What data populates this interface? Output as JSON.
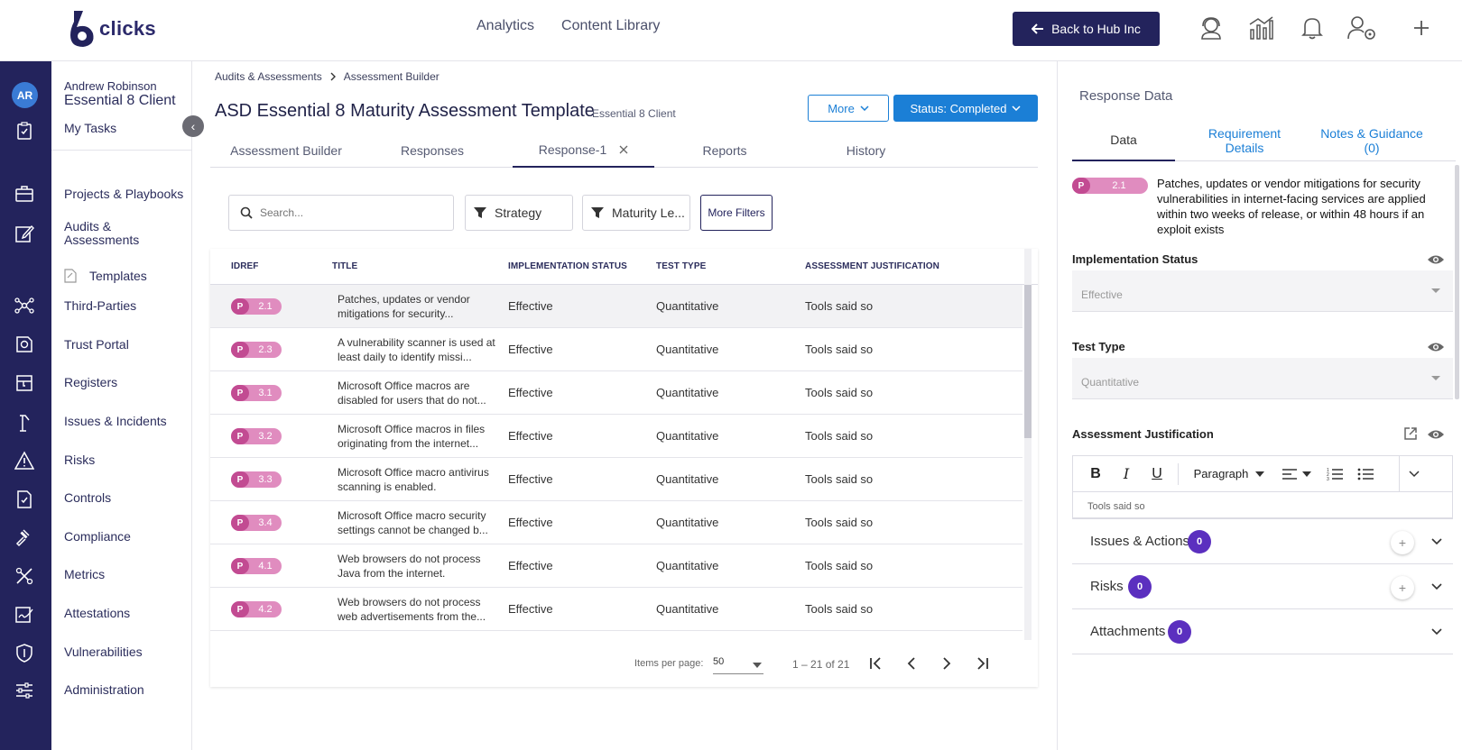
{
  "app": {
    "logo_text": "clicks",
    "nav": [
      "Analytics",
      "Content Library"
    ],
    "back_button": "Back to Hub Inc",
    "header_icons": [
      "support-icon",
      "analytics-icon",
      "bell-icon",
      "user-settings-icon",
      "plus-icon"
    ],
    "colors": {
      "navy": "#23235c",
      "blue": "#1b7fd6",
      "badge_pink": "#e08cbf",
      "badge_dark": "#c24b92",
      "count_purple": "#5b2fbf"
    }
  },
  "user": {
    "initials": "AR",
    "name": "Andrew Robinson",
    "client": "Essential 8 Client"
  },
  "sidebar": {
    "items": [
      {
        "label": "My Tasks"
      },
      {
        "label": "Projects & Playbooks"
      },
      {
        "label": "Audits & Assessments"
      },
      {
        "label": "Templates"
      },
      {
        "label": "Third-Parties"
      },
      {
        "label": "Trust Portal"
      },
      {
        "label": "Registers"
      },
      {
        "label": "Issues & Incidents"
      },
      {
        "label": "Risks"
      },
      {
        "label": "Controls"
      },
      {
        "label": "Compliance"
      },
      {
        "label": "Metrics"
      },
      {
        "label": "Attestations"
      },
      {
        "label": "Vulnerabilities"
      },
      {
        "label": "Administration"
      }
    ]
  },
  "breadcrumb": [
    "Audits & Assessments",
    "Assessment Builder"
  ],
  "page": {
    "title": "ASD Essential 8 Maturity Assessment Template",
    "subtitle": "Essential 8 Client",
    "more_label": "More",
    "status_label": "Status: Completed"
  },
  "tabs": [
    "Assessment Builder",
    "Responses",
    "Response-1",
    "Reports",
    "History"
  ],
  "active_tab": "Response-1",
  "filters": {
    "search_placeholder": "Search...",
    "strategy": "Strategy",
    "maturity": "Maturity Le...",
    "more_filters": "More Filters"
  },
  "table": {
    "columns": [
      "IDREF",
      "TITLE",
      "IMPLEMENTATION STATUS",
      "TEST TYPE",
      "ASSESSMENT JUSTIFICATION"
    ],
    "rows": [
      {
        "prefix": "P",
        "idref": "2.1",
        "title": "Patches, updates or vendor mitigations for security...",
        "status": "Effective",
        "test_type": "Quantitative",
        "justification": "Tools said so"
      },
      {
        "prefix": "P",
        "idref": "2.3",
        "title": "A vulnerability scanner is used at least daily to identify missi...",
        "status": "Effective",
        "test_type": "Quantitative",
        "justification": "Tools said so"
      },
      {
        "prefix": "P",
        "idref": "3.1",
        "title": "Microsoft Office macros are disabled for users that do not...",
        "status": "Effective",
        "test_type": "Quantitative",
        "justification": "Tools said so"
      },
      {
        "prefix": "P",
        "idref": "3.2",
        "title": "Microsoft Office macros in files originating from the internet...",
        "status": "Effective",
        "test_type": "Quantitative",
        "justification": "Tools said so"
      },
      {
        "prefix": "P",
        "idref": "3.3",
        "title": "Microsoft Office macro antivirus scanning is enabled.",
        "status": "Effective",
        "test_type": "Quantitative",
        "justification": "Tools said so"
      },
      {
        "prefix": "P",
        "idref": "3.4",
        "title": "Microsoft Office macro security settings cannot be changed b...",
        "status": "Effective",
        "test_type": "Quantitative",
        "justification": "Tools said so"
      },
      {
        "prefix": "P",
        "idref": "4.1",
        "title": "Web browsers do not process Java from the internet.",
        "status": "Effective",
        "test_type": "Quantitative",
        "justification": "Tools said so"
      },
      {
        "prefix": "P",
        "idref": "4.2",
        "title": "Web browsers do not process web advertisements from the...",
        "status": "Effective",
        "test_type": "Quantitative",
        "justification": "Tools said so"
      }
    ],
    "items_per_page_label": "Items per page:",
    "items_per_page": "50",
    "range": "1 – 21 of 21"
  },
  "panel": {
    "title": "Response Data",
    "tabs": [
      "Data",
      "Requirement Details",
      "Notes & Guidance (0)"
    ],
    "req_prefix": "P",
    "req_id": "2.1",
    "req_text": "Patches, updates or vendor mitigations for security vulnerabilities in internet-facing services are applied within two weeks of release, or within 48 hours if an exploit exists",
    "impl_label": "Implementation Status",
    "impl_value": "Effective",
    "test_label": "Test Type",
    "test_value": "Quantitative",
    "justification_label": "Assessment Justification",
    "editor_paragraph": "Paragraph",
    "editor_text": "Tools said so",
    "sections": [
      {
        "label": "Issues & Actions",
        "count": "0",
        "addable": true
      },
      {
        "label": "Risks",
        "count": "0",
        "addable": true
      },
      {
        "label": "Attachments",
        "count": "0",
        "addable": false
      }
    ]
  }
}
